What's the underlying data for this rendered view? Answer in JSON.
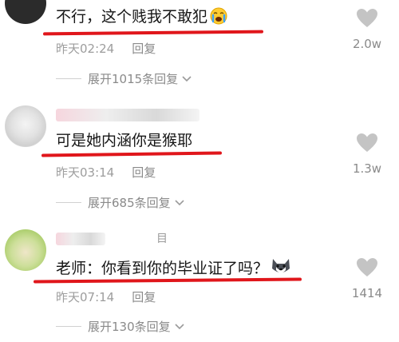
{
  "comments": [
    {
      "text": "不行，这个贱我不敢犯",
      "time": "昨天02:24",
      "reply_label": "回复",
      "expand_label": "展开1015条回复",
      "likes": "2.0w",
      "emoji": "crying-face-emoji"
    },
    {
      "text": "可是她内涵你是猴耶",
      "time": "昨天03:14",
      "reply_label": "回复",
      "expand_label": "展开685条回复",
      "likes": "1.3w"
    },
    {
      "username_tail": "目",
      "text": "老师：你看到你的毕业证了吗？",
      "time": "昨天07:14",
      "reply_label": "回复",
      "expand_label": "展开130条回复",
      "likes": "1414",
      "emoji": "husky-dog-emoji"
    }
  ],
  "colors": {
    "underline": "#e0161b",
    "meta_text": "#9d9d9d",
    "heart": "#c4c4c4"
  }
}
